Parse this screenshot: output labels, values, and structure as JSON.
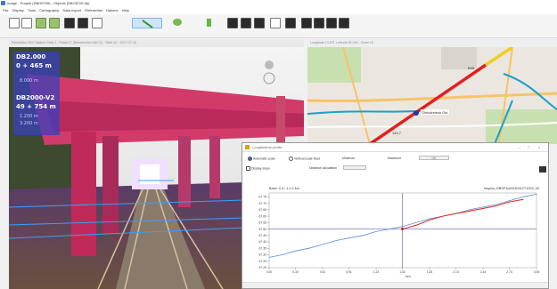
{
  "window": {
    "title": "Image - Projekt (DBO5705) - Objects (DBO5705.rlp)"
  },
  "menu": [
    "File",
    "Display",
    "Tools",
    "Cartography",
    "Data export",
    "Referential",
    "Options",
    "Help"
  ],
  "toolbar": {
    "icons": [
      "save-icon",
      "open-icon",
      "grid-icon",
      "grid-icon",
      "camera-icon",
      "film-icon",
      "zoom-icon",
      "line-tool-icon",
      "eye-icon",
      "battery-icon",
      "layer-icon",
      "layer-icon",
      "layer-icon",
      "panel-icon",
      "grid-icon",
      "map-icon",
      "map-icon",
      "map-icon",
      "map-icon"
    ]
  },
  "panorama": {
    "header": "Eisenbahn 2017 Station Gleis 1 - Punkt 17 (Streckenkm 146.71) - Sicht 12 - 2017-07-15",
    "overlay": {
      "line1": "DB2.000",
      "line2": "0 + 465 m",
      "line3": "",
      "line4": "8.000 m",
      "line5": "DB2000-V2",
      "line6": "49 + 754 m",
      "line7": "1.200 m",
      "line8": "3.200 m"
    }
  },
  "map": {
    "header": "Longitude 13.571 Latitude 52.345 - Zoom 15",
    "labels": {
      "station": "Gleisdreieck Ost",
      "road": "B96",
      "km": "146.7"
    },
    "colors": {
      "track_red": "#e02020",
      "track_yellow": "#f0d020",
      "track_teal": "#1aa0c8",
      "street": "#f6c36a",
      "water": "#9cc8e8",
      "park": "#c8dfb0"
    }
  },
  "profile": {
    "title": "Longitudinal profile",
    "auto_scale": "Automatic scale",
    "vertical_fixed": "Vertical scale fixed",
    "minimum_label": "Minimum",
    "maximum_label": "Maximum",
    "ok_label": "OK",
    "display_slope": "Display slope",
    "distance_calc": "Distance calculation",
    "chart_label": "Base: 0.4 / 1:1.0 km",
    "file_label": "insplus_DBSP1p20161112T1023_00",
    "x_axis_label": "km"
  },
  "chart_data": {
    "type": "line",
    "title": "",
    "xlabel": "km",
    "ylabel": "m",
    "x_ticks": [
      "0.00",
      "0.30",
      "0.61",
      "0.91",
      "1.22",
      "1.52",
      "1.83",
      "2.13",
      "2.44",
      "2.74",
      "3.05"
    ],
    "y_ticks": [
      "67.75",
      "67.70",
      "67.65",
      "67.60",
      "67.55",
      "67.50",
      "67.45",
      "67.40",
      "67.35",
      "67.30",
      "67.25",
      "67.20"
    ],
    "xlim": [
      0,
      3.05
    ],
    "ylim": [
      67.2,
      67.78
    ],
    "series": [
      {
        "color": "#5b8fd6",
        "x": [
          0.0,
          0.15,
          0.3,
          0.45,
          0.61,
          0.76,
          0.91,
          1.07,
          1.22,
          1.37,
          1.52,
          1.68,
          1.83,
          1.98,
          2.13,
          2.29,
          2.44,
          2.59,
          2.74,
          2.9,
          3.05
        ],
        "y": [
          67.28,
          67.3,
          67.33,
          67.35,
          67.38,
          67.41,
          67.43,
          67.45,
          67.48,
          67.5,
          67.52,
          67.55,
          67.58,
          67.6,
          67.62,
          67.65,
          67.67,
          67.69,
          67.72,
          67.75,
          67.77
        ]
      },
      {
        "color": "#e03030",
        "x": [
          1.52,
          1.68,
          1.83,
          1.98,
          2.13,
          2.29,
          2.44,
          2.59,
          2.74,
          2.9
        ],
        "y": [
          67.5,
          67.53,
          67.57,
          67.6,
          67.62,
          67.64,
          67.66,
          67.68,
          67.71,
          67.73
        ]
      }
    ],
    "cursor_x": 1.52,
    "cursor_y": 67.5,
    "grid": false,
    "legend": "none"
  }
}
